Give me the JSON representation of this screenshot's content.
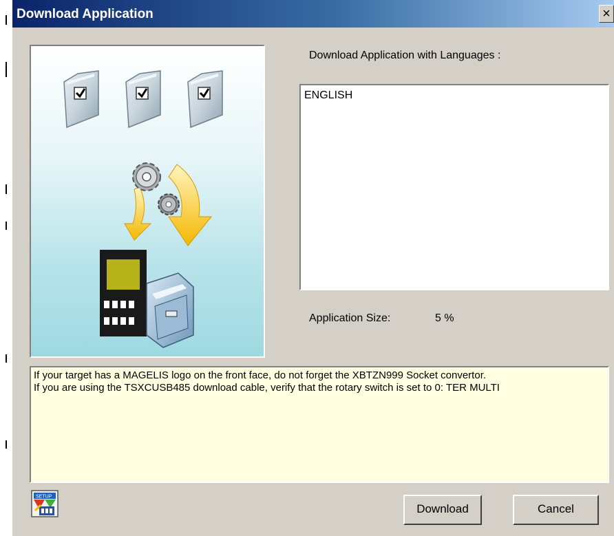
{
  "window": {
    "title": "Download Application",
    "close_glyph": "×"
  },
  "languages": {
    "label": "Download Application with Languages :",
    "items": [
      "ENGLISH"
    ]
  },
  "application_size": {
    "label": "Application Size:",
    "value": "5 %"
  },
  "message": {
    "lines": [
      "If your target has a MAGELIS logo on the front face, do not forget the XBTZN999 Socket convertor.",
      "If you are using the TSXCUSB485 download cable, verify that the rotary switch is set to 0: TER MULTI"
    ]
  },
  "buttons": {
    "download_label": "Download",
    "cancel_label": "Cancel"
  },
  "icons": {
    "illustration": "download-application-illustration",
    "setup": "setup-icon",
    "folders": "checked-folder-icon",
    "gears": "gear-icon",
    "arrows": "download-arrow-icon",
    "terminal": "magelis-terminal-icon"
  },
  "colors": {
    "titlebar_start": "#0a246a",
    "titlebar_end": "#a6caf0",
    "message_background": "#ffffe1",
    "dialog_background": "#d4d0c8"
  }
}
